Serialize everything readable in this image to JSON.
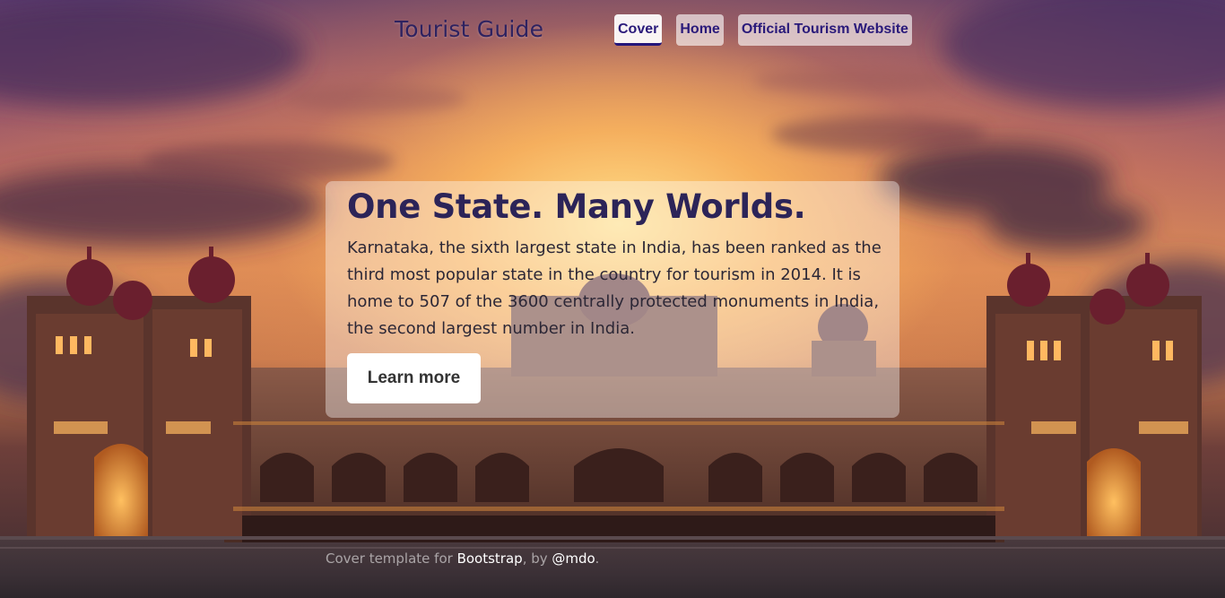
{
  "header": {
    "brand": "Tourist Guide",
    "nav": [
      {
        "label": "Cover",
        "active": true
      },
      {
        "label": "Home",
        "active": false
      },
      {
        "label": "Official Tourism Website",
        "active": false
      }
    ]
  },
  "hero": {
    "heading": "One State. Many Worlds.",
    "text": "Karnataka, the sixth largest state in India, has been ranked as the third most popular state in the country for tourism in 2014. It is home to 507 of the 3600 centrally protected monuments in India, the second largest number in India.",
    "button_label": "Learn more"
  },
  "footer": {
    "prefix": "Cover template for ",
    "link1": "Bootstrap",
    "middle": ", by ",
    "link2": "@mdo",
    "suffix": "."
  },
  "colors": {
    "accent": "#2a1a7a",
    "heading": "#2c2458"
  }
}
